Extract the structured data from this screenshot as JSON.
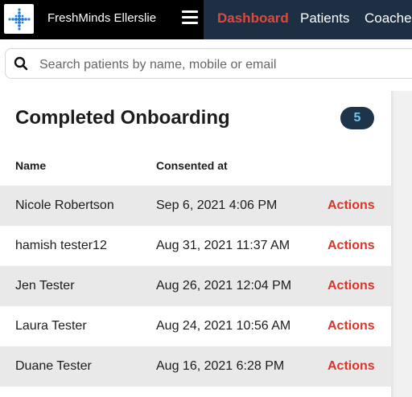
{
  "brand": {
    "name": "FreshMinds Ellerslie",
    "logo_icon": "dotted-cross-logo-icon"
  },
  "nav": {
    "menu_icon": "hamburger-menu-icon",
    "items": [
      {
        "label": "Dashboard",
        "active": true
      },
      {
        "label": "Patients",
        "active": false
      },
      {
        "label": "Coaches",
        "active": false
      }
    ]
  },
  "search": {
    "placeholder": "Search patients by name, mobile or email",
    "value": "",
    "icon": "search-icon"
  },
  "card": {
    "title": "Completed Onboarding",
    "count": "5",
    "columns": {
      "name": "Name",
      "consented_at": "Consented at"
    },
    "rows": [
      {
        "name": "Nicole Robertson",
        "consented_at": "Sep 6, 2021 4:06 PM",
        "action": "Actions"
      },
      {
        "name": "hamish tester12",
        "consented_at": "Aug 31, 2021 11:37 AM",
        "action": "Actions"
      },
      {
        "name": "Jen Tester",
        "consented_at": "Aug 26, 2021 12:04 PM",
        "action": "Actions"
      },
      {
        "name": "Laura Tester",
        "consented_at": "Aug 24, 2021 10:56 AM",
        "action": "Actions"
      },
      {
        "name": "Duane Tester",
        "consented_at": "Aug 16, 2021 6:28 PM",
        "action": "Actions"
      }
    ]
  },
  "colors": {
    "accent": "#e0483a",
    "nav_bg": "#1e2f44",
    "badge_bg": "#1e3448",
    "badge_text": "#6fc5ef",
    "action": "#d9352b"
  }
}
